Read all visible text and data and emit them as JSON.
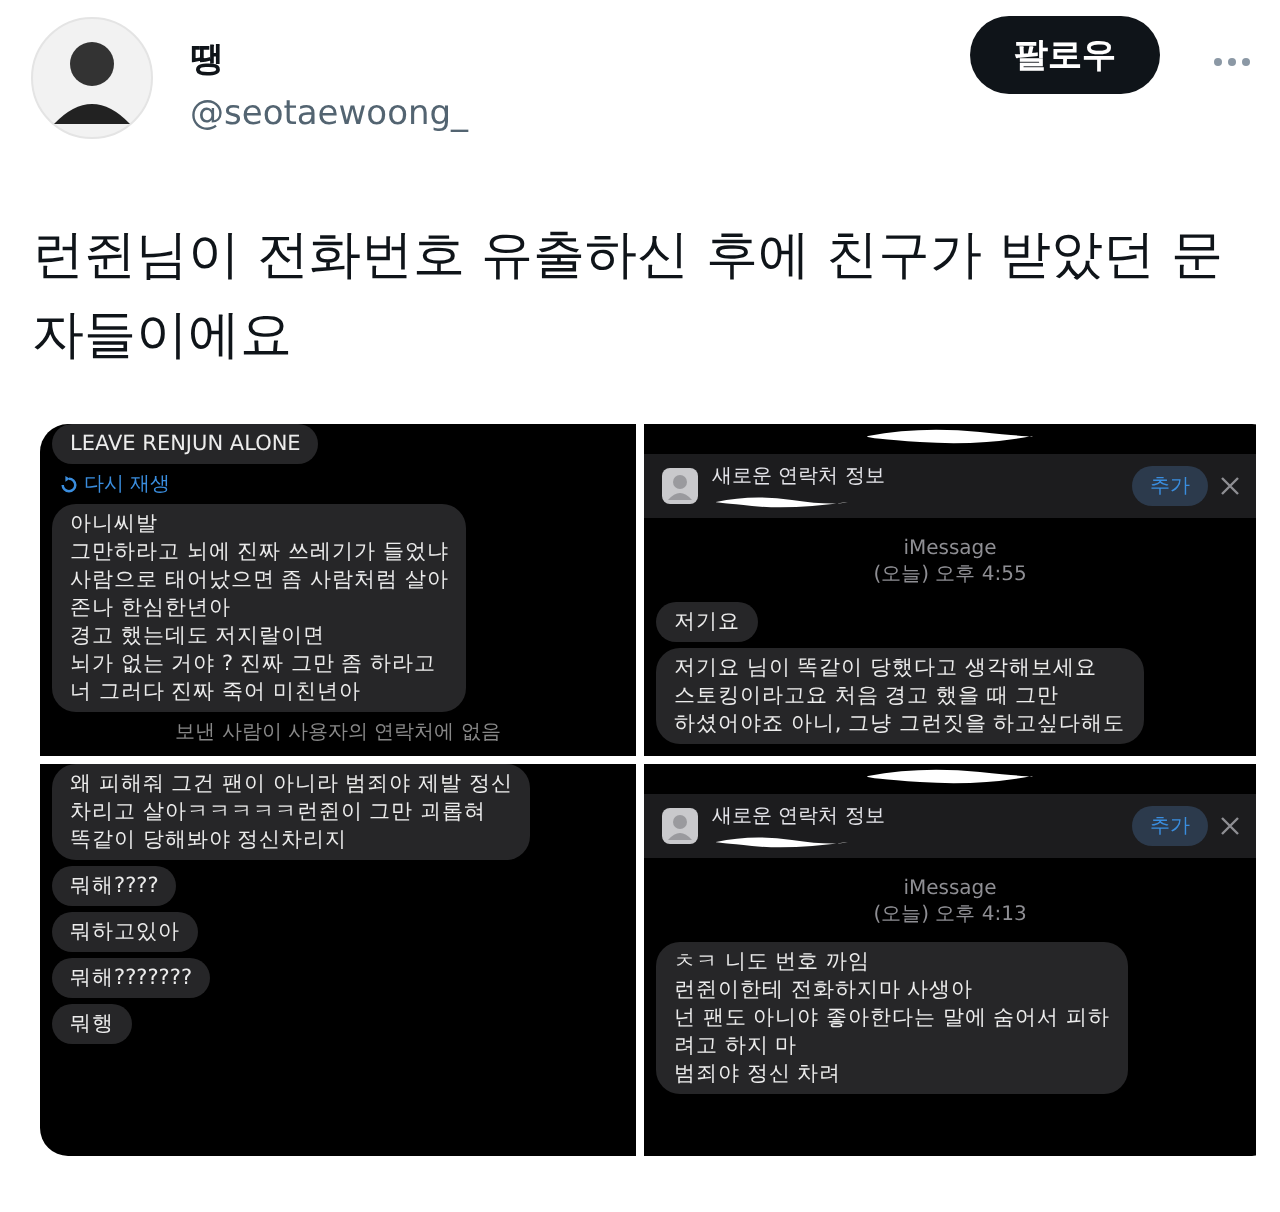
{
  "author": {
    "name": "땡",
    "handle": "@seotaewoong_"
  },
  "follow_button": "팔로우",
  "text": "런쥔님이 전화번호 유출하신 후에 친구가 받았던 문자들이에요",
  "images": [
    {
      "items": [
        {
          "kind": "bubble",
          "text": "LEAVE RENJUN ALONE"
        },
        {
          "kind": "replay",
          "text": "다시 재생"
        },
        {
          "kind": "bubble",
          "text": "아니씨발\n그만하라고 뇌에 진짜 쓰레기가 들었냐\n사람으로 태어났으면 좀 사람처럼 살아\n존나 한심한년아\n경고 했는데도 저지랄이면\n뇌가 없는 거야 ? 진짜 그만 좀 하라고\n너 그러다 진짜 죽어 미친년아"
        },
        {
          "kind": "note",
          "text": "보낸 사람이 사용자의 연락처에 없음"
        }
      ]
    },
    {
      "items": [
        {
          "kind": "banner",
          "text": "새로운 연락처 정보",
          "button": "추가"
        },
        {
          "kind": "timestamp",
          "service": "iMessage",
          "text": "(오늘) 오후 4:55"
        },
        {
          "kind": "bubble",
          "text": "저기요"
        },
        {
          "kind": "bubble",
          "text": "저기요 님이 똑같이 당했다고 생각해보세요\n스토킹이라고요 처음 경고 했을 때 그만\n하셨어야죠 아니, 그냥 그런짓을 하고싶다해도"
        }
      ]
    },
    {
      "items": [
        {
          "kind": "bubble",
          "text": "왜 피해줘 그건 팬이 아니라 범죄야 제발 정신\n차리고 살아ㅋㅋㅋㅋㅋ런쥔이 그만 괴롭혀\n똑같이 당해봐야 정신차리지"
        },
        {
          "kind": "bubble",
          "text": "뭐해????"
        },
        {
          "kind": "bubble",
          "text": "뭐하고있아"
        },
        {
          "kind": "bubble",
          "text": "뭐해???????"
        },
        {
          "kind": "bubble",
          "text": "뭐행"
        }
      ]
    },
    {
      "items": [
        {
          "kind": "banner",
          "text": "새로운 연락처 정보",
          "button": "추가"
        },
        {
          "kind": "timestamp",
          "service": "iMessage",
          "text": "(오늘) 오후 4:13"
        },
        {
          "kind": "bubble",
          "text": "ㅊㅋ 니도 번호 까임\n런쥔이한테 전화하지마 사생아\n넌 팬도 아니야 좋아한다는 말에 숨어서 피하\n려고 하지 마\n범죄야 정신 차려"
        }
      ]
    }
  ]
}
